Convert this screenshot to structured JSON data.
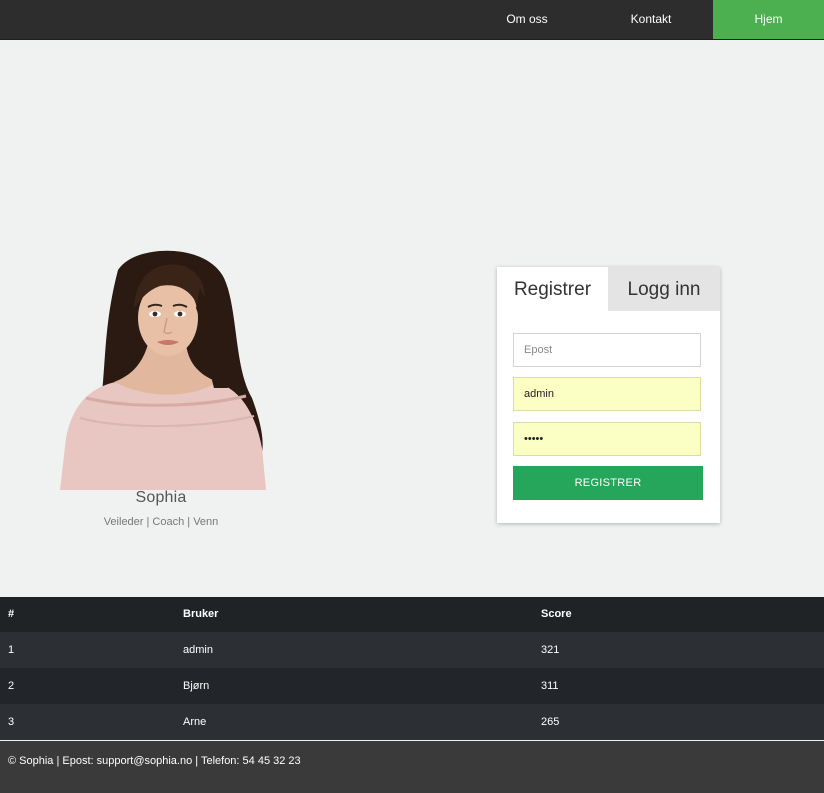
{
  "nav": {
    "items": [
      {
        "label": "Om oss"
      },
      {
        "label": "Kontakt"
      },
      {
        "label": "Hjem"
      }
    ]
  },
  "profile": {
    "name": "Sophia",
    "tagline": "Veileder | Coach | Venn"
  },
  "form": {
    "tabs": [
      {
        "label": "Registrer",
        "active": true
      },
      {
        "label": "Logg inn",
        "active": false
      }
    ],
    "email_placeholder": "Epost",
    "email_value": "",
    "username_value": "admin",
    "password_value": "admin",
    "submit_label": "REGISTRER"
  },
  "table": {
    "headers": [
      "#",
      "Bruker",
      "Score"
    ],
    "rows": [
      [
        "1",
        "admin",
        "321"
      ],
      [
        "2",
        "Bjørn",
        "311"
      ],
      [
        "3",
        "Arne",
        "265"
      ]
    ]
  },
  "footer": {
    "text": "© Sophia | Epost: support@sophia.no | Telefon: 54 45 32 23"
  },
  "colors": {
    "nav_bg": "#2d2d2d",
    "nav_active": "#4caf50",
    "submit_green": "#25a65b",
    "autofill_yellow": "#fbffc3",
    "table_header": "#1f2326",
    "footer_bg": "#3a3a3a"
  }
}
